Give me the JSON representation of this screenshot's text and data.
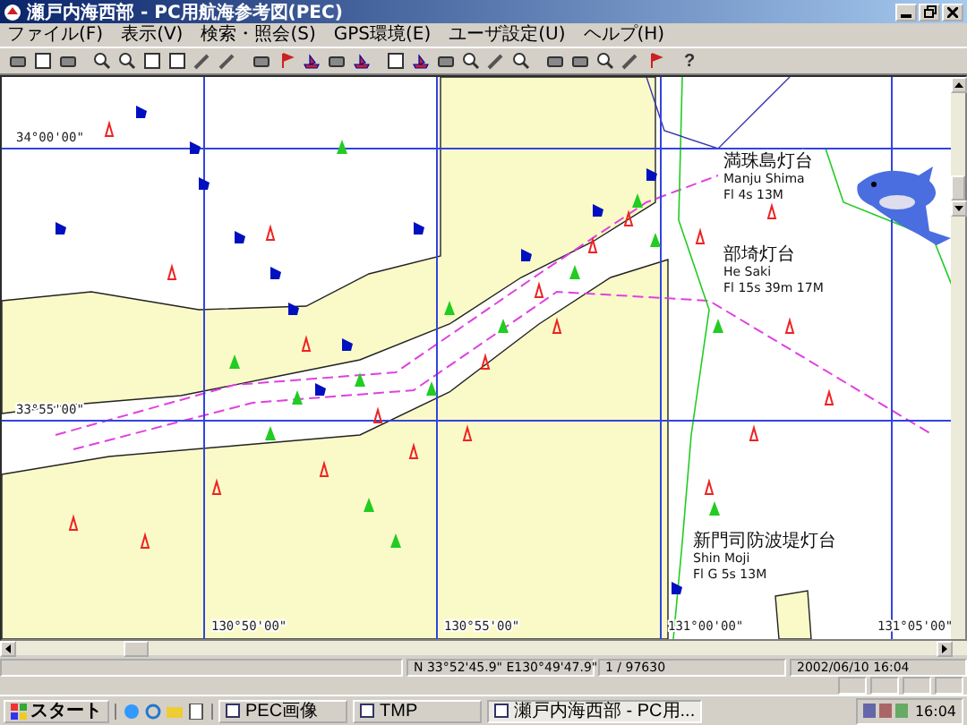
{
  "window": {
    "title": "瀬戸内海西部 - PC用航海参考図(PEC)"
  },
  "menu": [
    "ファイル(F)",
    "表示(V)",
    "検索・照会(S)",
    "GPS環境(E)",
    "ユーザ設定(U)",
    "ヘルプ(H)"
  ],
  "toolbar": {
    "help": "?"
  },
  "chart": {
    "latitudes": [
      "34°00'00\"",
      "33°55'00\""
    ],
    "longitudes": [
      "130°50'00\"",
      "130°55'00\"",
      "131°00'00\"",
      "131°05'00\""
    ],
    "lights": [
      {
        "name_ja": "満珠島灯台",
        "name": "Manju Shima",
        "characteristic": "Fl 4s  13M"
      },
      {
        "name_ja": "部埼灯台",
        "name": "He Saki",
        "characteristic": "Fl 15s 39m 17M"
      },
      {
        "name_ja": "新門司防波堤灯台",
        "name": "Shin Moji",
        "characteristic": "Fl G 5s  13M"
      }
    ]
  },
  "status_bar": {
    "position": "N 33°52'45.9\" E130°49'47.9\"",
    "scale": "1 / 97630",
    "datetime": "2002/06/10 16:04"
  },
  "taskbar": {
    "start": "スタート",
    "tasks": [
      {
        "label": "PEC画像",
        "selected": false
      },
      {
        "label": "TMP",
        "selected": false
      },
      {
        "label": "瀬戸内海西部 - PC用...",
        "selected": true
      }
    ],
    "clock": "16:04"
  }
}
